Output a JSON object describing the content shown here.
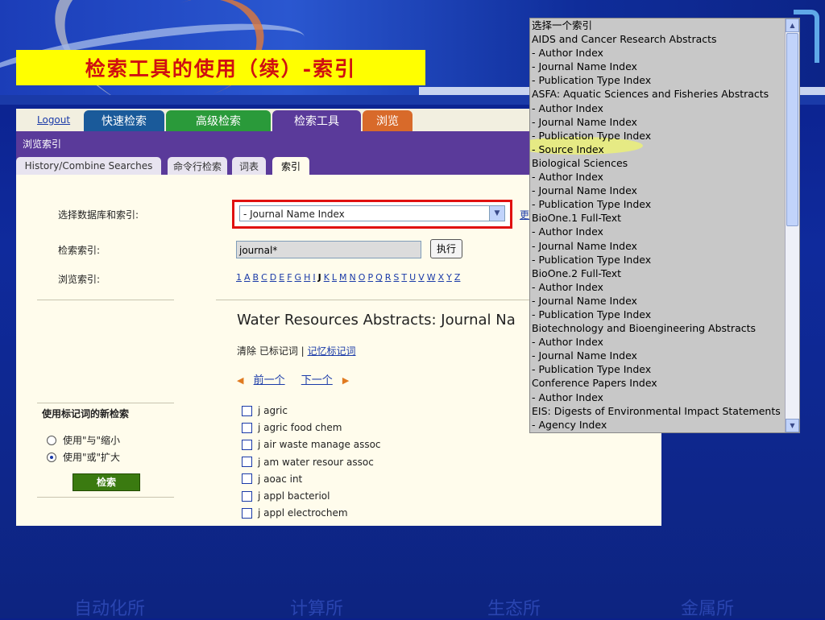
{
  "slide": {
    "title": "检索工具的使用（续）-索引",
    "footer": [
      "自动化所",
      "计算所",
      "生态所",
      "金属所"
    ]
  },
  "app": {
    "logout": "Logout",
    "tabs": [
      "快速检索",
      "高级检索",
      "检索工具",
      "浏览"
    ],
    "browse_label": "浏览索引",
    "subtabs": [
      "History/Combine Searches",
      "命令行检索",
      "词表",
      "索引"
    ],
    "select_label": "选择数据库和索引:",
    "select_value": "- Journal Name Index",
    "more_link": "更",
    "query_label": "检索索引:",
    "query_value": "journal*",
    "exec_label": "执行",
    "browse_index_label": "浏览索引:",
    "alphabet": [
      "1",
      "A",
      "B",
      "C",
      "D",
      "E",
      "F",
      "G",
      "H",
      "I",
      "J",
      "K",
      "L",
      "M",
      "N",
      "O",
      "P",
      "Q",
      "R",
      "S",
      "T",
      "U",
      "V",
      "W",
      "X",
      "Y",
      "Z"
    ],
    "current_letter": "J",
    "result_title": "Water Resources Abstracts: Journal Na",
    "clear_label": "清除 已标记词 |",
    "remember_link": "记忆标记词",
    "prev": "前一个",
    "next": "下一个",
    "terms": [
      "j agric",
      "j agric food chem",
      "j air waste manage assoc",
      "j am water resour assoc",
      "j aoac int",
      "j appl bacteriol",
      "j appl electrochem"
    ],
    "new_search_title": "使用标记词的新检索",
    "radio_and": "使用\"与\"缩小",
    "radio_or": "使用\"或\"扩大",
    "search_button": "检索"
  },
  "dropdown": {
    "items": [
      "选择一个索引",
      "AIDS and Cancer Research Abstracts",
      "- Author Index",
      "- Journal Name Index",
      "- Publication Type Index",
      "ASFA: Aquatic Sciences and Fisheries Abstracts",
      "- Author Index",
      "- Journal Name Index",
      "- Publication Type Index",
      "- Source Index",
      "Biological Sciences",
      "- Author Index",
      "- Journal Name Index",
      "- Publication Type Index",
      "BioOne.1 Full-Text",
      "- Author Index",
      "- Journal Name Index",
      "- Publication Type Index",
      "BioOne.2 Full-Text",
      "- Author Index",
      "- Journal Name Index",
      "- Publication Type Index",
      "Biotechnology and Bioengineering Abstracts",
      "- Author Index",
      "- Journal Name Index",
      "- Publication Type Index",
      "Conference Papers Index",
      "- Author Index",
      "EIS: Digests of Environmental Impact Statements",
      "- Agency Index"
    ],
    "highlighted_index": 9
  }
}
